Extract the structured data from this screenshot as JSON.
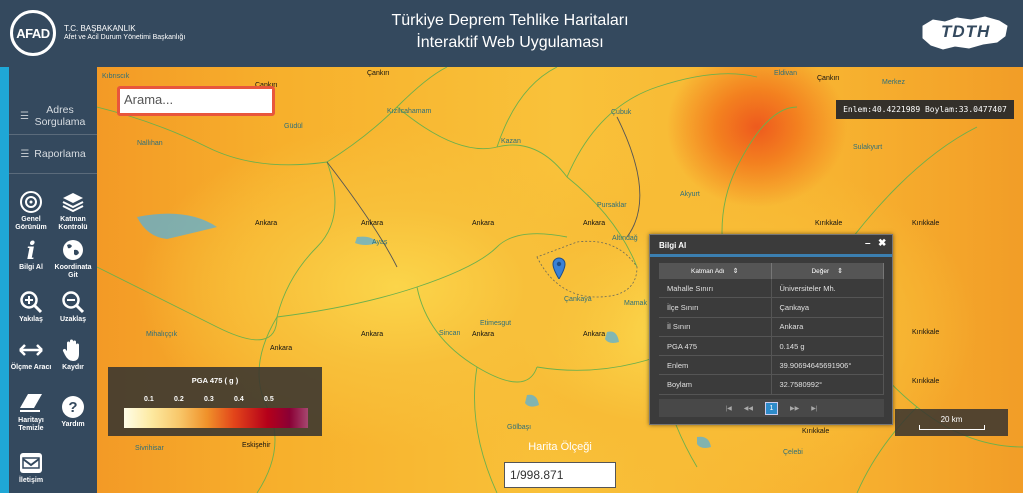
{
  "header": {
    "afad_logo": "AFAD",
    "org_line1": "T.C. BAŞBAKANLIK",
    "org_line2": "Afet ve Acil Durum Yönetimi Başkanlığı",
    "title_line1": "Türkiye Deprem Tehlike Haritaları",
    "title_line2": "İnteraktif Web Uygulaması",
    "tdth_logo": "TDTH"
  },
  "sidebar": {
    "links": [
      {
        "label": "Adres Sorgulama",
        "icon": "list-icon"
      },
      {
        "label": "Raporlama",
        "icon": "list-icon"
      }
    ],
    "tools": [
      {
        "label": "Genel Görünüm",
        "icon": "crosshair-icon"
      },
      {
        "label": "Katman Kontrolü",
        "icon": "layers-icon"
      },
      {
        "label": "Bilgi Al",
        "icon": "info-icon"
      },
      {
        "label": "Koordinata Git",
        "icon": "globe-icon"
      },
      {
        "label": "Yakılaş",
        "icon": "zoom-in-icon"
      },
      {
        "label": "Uzaklaş",
        "icon": "zoom-out-icon"
      },
      {
        "label": "Ölçme Aracı",
        "icon": "measure-icon"
      },
      {
        "label": "Kaydır",
        "icon": "hand-icon"
      },
      {
        "label": "Haritayı Temizle",
        "icon": "eraser-icon"
      },
      {
        "label": "Yardım",
        "icon": "help-icon"
      },
      {
        "label": "İletişim",
        "icon": "mail-icon"
      }
    ]
  },
  "map": {
    "search_placeholder": "Arama...",
    "coordinates": "Enlem:40.4221989 Boylam:33.0477407",
    "scale_label": "Harita Ölçeği",
    "scale_value": "1/998.871",
    "scalebar_label": "20 km",
    "places": [
      {
        "name": "Nallıhan",
        "kind": "sub"
      },
      {
        "name": "Güdül",
        "kind": "sub"
      },
      {
        "name": "Kızılcahamam",
        "kind": "sub"
      },
      {
        "name": "Kazan",
        "kind": "sub"
      },
      {
        "name": "Çubuk",
        "kind": "sub"
      },
      {
        "name": "Çankırı",
        "kind": "city"
      },
      {
        "name": "Çankırı",
        "kind": "city"
      },
      {
        "name": "Çankırı",
        "kind": "city"
      },
      {
        "name": "Ankara",
        "kind": "city"
      },
      {
        "name": "Ankara",
        "kind": "city"
      },
      {
        "name": "Ankara",
        "kind": "city"
      },
      {
        "name": "Ankara",
        "kind": "city"
      },
      {
        "name": "Ankara",
        "kind": "city"
      },
      {
        "name": "Ankara",
        "kind": "city"
      },
      {
        "name": "Ankara",
        "kind": "city"
      },
      {
        "name": "Ankara",
        "kind": "city"
      },
      {
        "name": "Ayaş",
        "kind": "sub"
      },
      {
        "name": "Sincan",
        "kind": "sub"
      },
      {
        "name": "Etimesgut",
        "kind": "sub"
      },
      {
        "name": "Çankaya",
        "kind": "sub"
      },
      {
        "name": "Pursaklar",
        "kind": "sub"
      },
      {
        "name": "Altındağ",
        "kind": "sub"
      },
      {
        "name": "Mamak",
        "kind": "sub"
      },
      {
        "name": "Akyurt",
        "kind": "sub"
      },
      {
        "name": "Kırıkkale",
        "kind": "city"
      },
      {
        "name": "Kırıkkale",
        "kind": "city"
      },
      {
        "name": "Kırıkkale",
        "kind": "city"
      },
      {
        "name": "Kırıkkale",
        "kind": "city"
      },
      {
        "name": "Kırıkkale",
        "kind": "city"
      },
      {
        "name": "Sulakyurt",
        "kind": "sub"
      },
      {
        "name": "Merkez",
        "kind": "sub"
      },
      {
        "name": "Eldivan",
        "kind": "sub"
      },
      {
        "name": "Mihalıççık",
        "kind": "sub"
      },
      {
        "name": "Eskişehir",
        "kind": "city"
      },
      {
        "name": "Gölbaşı",
        "kind": "sub"
      },
      {
        "name": "Çelebi",
        "kind": "sub"
      },
      {
        "name": "Sivrihisar",
        "kind": "sub"
      },
      {
        "name": "Kıbrıscık",
        "kind": "sub"
      }
    ]
  },
  "legend": {
    "title": "PGA 475 ( g )",
    "ticks": [
      "0.1",
      "0.2",
      "0.3",
      "0.4",
      "0.5"
    ]
  },
  "panel": {
    "title": "Bilgi Al",
    "minimize": "–",
    "close": "✖",
    "columns": [
      "Katman Adı",
      "Değer"
    ],
    "rows": [
      [
        "Mahalle Sınırı",
        "Üniversiteler Mh."
      ],
      [
        "İlçe Sınırı",
        "Çankaya"
      ],
      [
        "İl Sınırı",
        "Ankara"
      ],
      [
        "PGA 475",
        "0.145 g"
      ],
      [
        "Enlem",
        "39.90694645691906°"
      ],
      [
        "Boylam",
        "32.7580992°"
      ]
    ],
    "pager": {
      "first": "|◀",
      "prev": "◀◀",
      "current": "1",
      "next": "▶▶",
      "last": "▶|"
    }
  },
  "colors": {
    "header_bg": "#34495e",
    "accent": "#1fa7d6",
    "search_border": "#e8563c",
    "hazard_high": "#ee5a1e"
  }
}
